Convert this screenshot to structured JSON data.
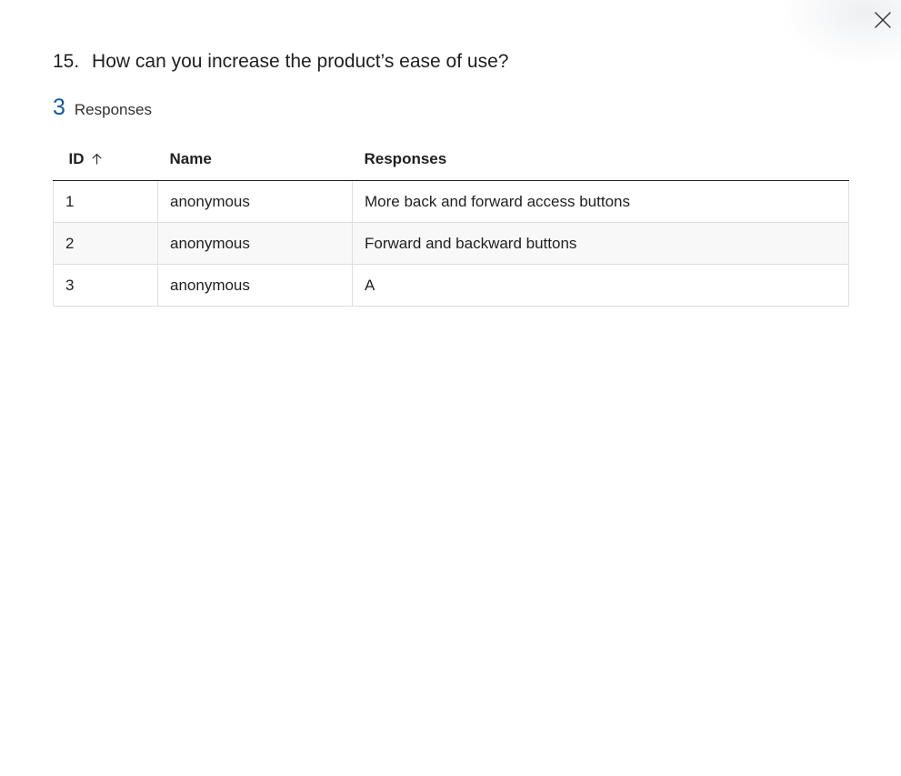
{
  "question": {
    "number": "15.",
    "text": "How can you increase the product’s ease of use?"
  },
  "summary": {
    "count": "3",
    "label": "Responses"
  },
  "table": {
    "columns": [
      {
        "label": "ID",
        "sort_icon": "arrow-up-icon"
      },
      {
        "label": "Name"
      },
      {
        "label": "Responses"
      }
    ],
    "rows": [
      {
        "id": "1",
        "name": "anonymous",
        "response": "More back and forward access buttons"
      },
      {
        "id": "2",
        "name": "anonymous",
        "response": "Forward and backward buttons"
      },
      {
        "id": "3",
        "name": "anonymous",
        "response": "A"
      }
    ]
  },
  "colors": {
    "accent": "#0f5a9c",
    "text": "#201f1e",
    "row_alt": "#f8f8f8",
    "border": "#e1dfdd"
  },
  "icons": {
    "close": "close-icon"
  }
}
